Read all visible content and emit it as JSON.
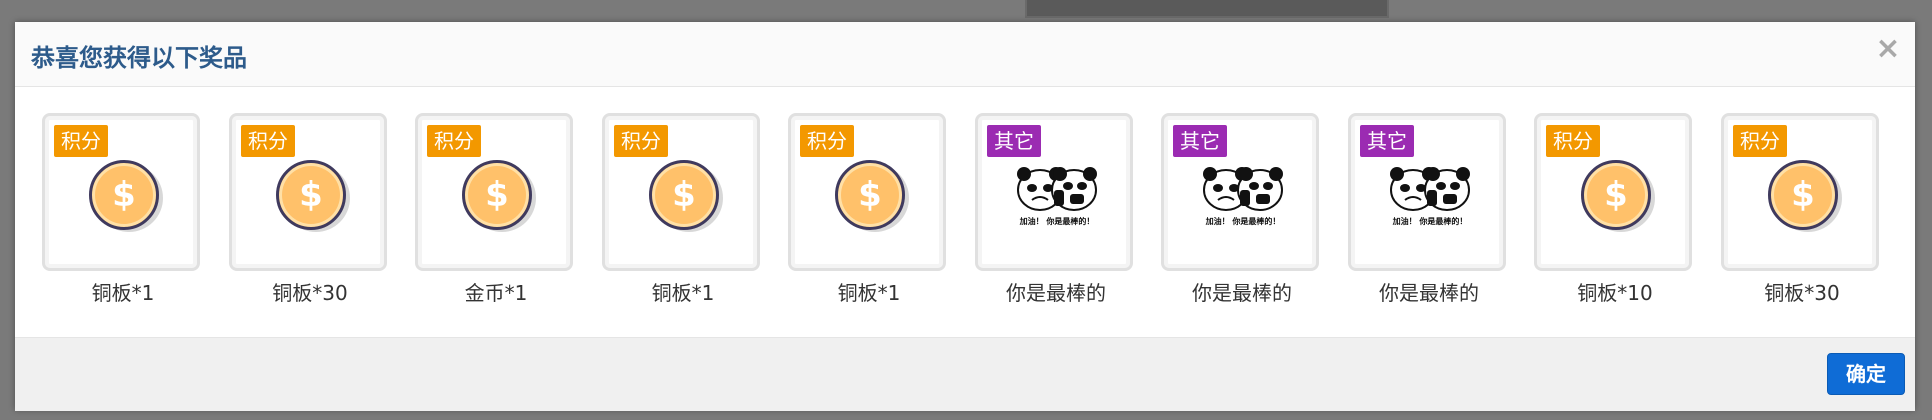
{
  "dialog": {
    "title": "恭喜您获得以下奖品",
    "close_symbol": "×",
    "confirm_label": "确定"
  },
  "colors": {
    "title": "#2d5b8b",
    "tag_points": "#f39800",
    "tag_other": "#9b2bb2",
    "confirm": "#0f6cd6"
  },
  "prizes": [
    {
      "tag": "积分",
      "tag_type": "points",
      "icon": "dollar-coin-icon",
      "label": "铜板*1"
    },
    {
      "tag": "积分",
      "tag_type": "points",
      "icon": "dollar-coin-icon",
      "label": "铜板*30"
    },
    {
      "tag": "积分",
      "tag_type": "points",
      "icon": "dollar-coin-icon",
      "label": "金币*1"
    },
    {
      "tag": "积分",
      "tag_type": "points",
      "icon": "dollar-coin-icon",
      "label": "铜板*1"
    },
    {
      "tag": "积分",
      "tag_type": "points",
      "icon": "dollar-coin-icon",
      "label": "铜板*1"
    },
    {
      "tag": "其它",
      "tag_type": "other",
      "icon": "panda-meme-image",
      "meme_caption": "加油！ 你是最棒的！",
      "label": "你是最棒的"
    },
    {
      "tag": "其它",
      "tag_type": "other",
      "icon": "panda-meme-image",
      "meme_caption": "加油！ 你是最棒的！",
      "label": "你是最棒的"
    },
    {
      "tag": "其它",
      "tag_type": "other",
      "icon": "panda-meme-image",
      "meme_caption": "加油！ 你是最棒的！",
      "label": "你是最棒的"
    },
    {
      "tag": "积分",
      "tag_type": "points",
      "icon": "dollar-coin-icon",
      "label": "铜板*10"
    },
    {
      "tag": "积分",
      "tag_type": "points",
      "icon": "dollar-coin-icon",
      "label": "铜板*30"
    }
  ]
}
